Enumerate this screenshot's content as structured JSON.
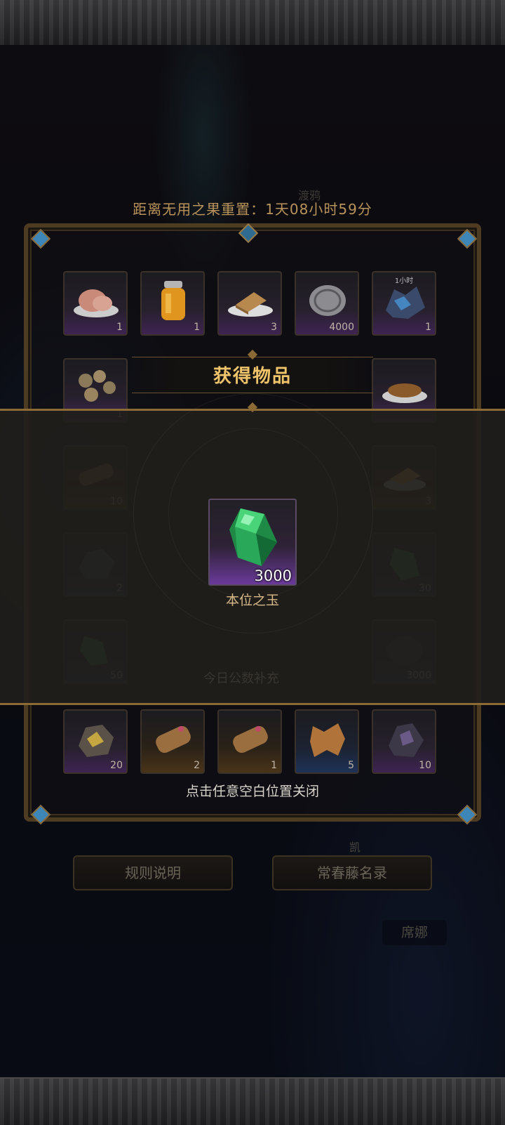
{
  "countdown": "距离无用之果重置：1天08小时59分",
  "background_labels": {
    "top": "渡鸦",
    "kai": "凯",
    "xina": "席娜",
    "middle": "今日公数补充"
  },
  "shop": {
    "rows": [
      [
        {
          "icon": "meat-plate-icon",
          "qty": "1",
          "rarity": "purple"
        },
        {
          "icon": "honey-jar-icon",
          "qty": "1",
          "rarity": "purple"
        },
        {
          "icon": "bread-plate-icon",
          "qty": "3",
          "rarity": "purple"
        },
        {
          "icon": "silver-coin-icon",
          "qty": "4000",
          "rarity": "purple"
        },
        {
          "icon": "blue-crystal-cluster-icon",
          "qty": "1",
          "rarity": "purple",
          "tag": "1小时"
        }
      ],
      [
        {
          "icon": "mushroom-cluster-icon",
          "qty": "1",
          "rarity": "purple"
        },
        {
          "icon": "roast-dish-icon",
          "qty": "",
          "rarity": "purple"
        }
      ],
      [
        {
          "icon": "scroll-bundle-icon",
          "qty": "10",
          "rarity": "orange"
        },
        {
          "icon": "cheese-plate-icon",
          "qty": "3",
          "rarity": "orange"
        }
      ],
      [
        {
          "icon": "blue-ore-icon",
          "qty": "2",
          "rarity": "blue"
        },
        {
          "icon": "green-gem-icon",
          "qty": "30",
          "rarity": "blue"
        }
      ],
      [
        {
          "icon": "green-shard-icon",
          "qty": "50",
          "rarity": "blue"
        },
        {
          "icon": "dark-stone-icon",
          "qty": "3000",
          "rarity": "blue"
        }
      ],
      [
        {
          "icon": "gold-ore-icon",
          "qty": "20",
          "rarity": "purple"
        },
        {
          "icon": "leather-scroll-icon",
          "qty": "2",
          "rarity": "orange"
        },
        {
          "icon": "leather-scroll-icon",
          "qty": "1",
          "rarity": "orange"
        },
        {
          "icon": "animal-hide-icon",
          "qty": "5",
          "rarity": "blue"
        },
        {
          "icon": "dark-ore-icon",
          "qty": "10",
          "rarity": "purple"
        }
      ]
    ]
  },
  "popup": {
    "title": "获得物品",
    "item": {
      "icon": "green-jade-crystal-icon",
      "name": "本位之玉",
      "qty": "3000"
    },
    "close_hint": "点击任意空白位置关闭"
  },
  "buttons": {
    "rules": "规则说明",
    "roster": "常春藤名录"
  },
  "colors": {
    "accent_gold": "#f0c46a",
    "frame_bronze": "#8b6a36",
    "rarity_purple": "#6a3a9a"
  }
}
